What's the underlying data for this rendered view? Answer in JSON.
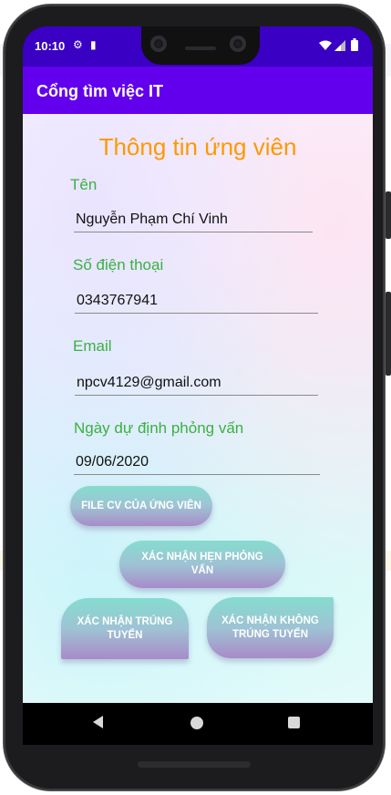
{
  "status_bar": {
    "time": "10:10",
    "settings_icon": "⚙",
    "sim_icon": "▮",
    "wifi_icon": "▾",
    "signal_icon": "◢",
    "battery_icon": "▮"
  },
  "app_bar": {
    "title": "Cổng tìm việc IT"
  },
  "form": {
    "title": "Thông tin ứng viên",
    "name_label": "Tên",
    "name_value": "Nguyễn Phạm Chí Vinh",
    "phone_label": "Số điện thoại",
    "phone_value": "0343767941",
    "email_label": "Email",
    "email_value": "npcv4129@gmail.com",
    "date_label": "Ngày dự định phỏng vấn",
    "date_value": "09/06/2020"
  },
  "buttons": {
    "cv_file": "FILE CV CỦA ỨNG VIÊN",
    "confirm_interview": "XÁC NHẬN HẸN PHỎNG VẤN",
    "confirm_hired": "XÁC NHẬN TRÚNG TUYỂN",
    "confirm_not_hired": "XÁC NHẬN KHÔNG TRÚNG TUYỂN"
  },
  "colors": {
    "status_bar": "#3a00c4",
    "app_bar": "#6200ee",
    "title_orange": "#ff9800",
    "label_green": "#3cb043"
  },
  "icons": [
    "gear-icon",
    "sim-card-icon",
    "wifi-icon",
    "signal-icon",
    "battery-icon",
    "back-icon",
    "home-icon",
    "recent-apps-icon"
  ]
}
